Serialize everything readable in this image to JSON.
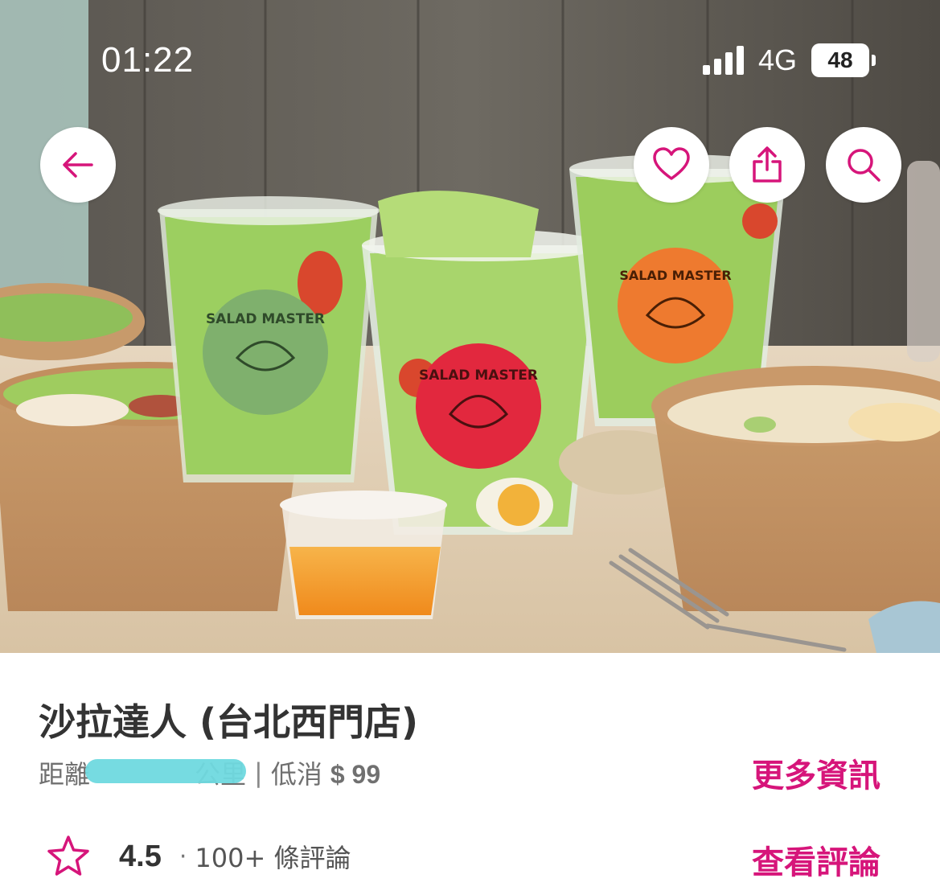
{
  "status_bar": {
    "time": "01:22",
    "network": "4G",
    "battery": "48"
  },
  "hero_image": {
    "sticker_text": "SALAD MASTER"
  },
  "header_actions": {
    "back_icon": "arrow-left-icon",
    "favorite_icon": "heart-icon",
    "share_icon": "share-icon",
    "search_icon": "search-icon"
  },
  "restaurant": {
    "name": "沙拉達人 (台北西門店)",
    "distance_label": "距離",
    "distance_unit": "公里",
    "separator": "|",
    "min_order_label": "低消",
    "min_order_value": "$ 99",
    "more_info_label": "更多資訊",
    "rating": "4.5",
    "rating_dot": "·",
    "review_count": "100+ 條評論",
    "view_reviews_label": "查看評論"
  },
  "colors": {
    "accent": "#d6157a",
    "text_primary": "#333333",
    "text_secondary": "#707070"
  }
}
